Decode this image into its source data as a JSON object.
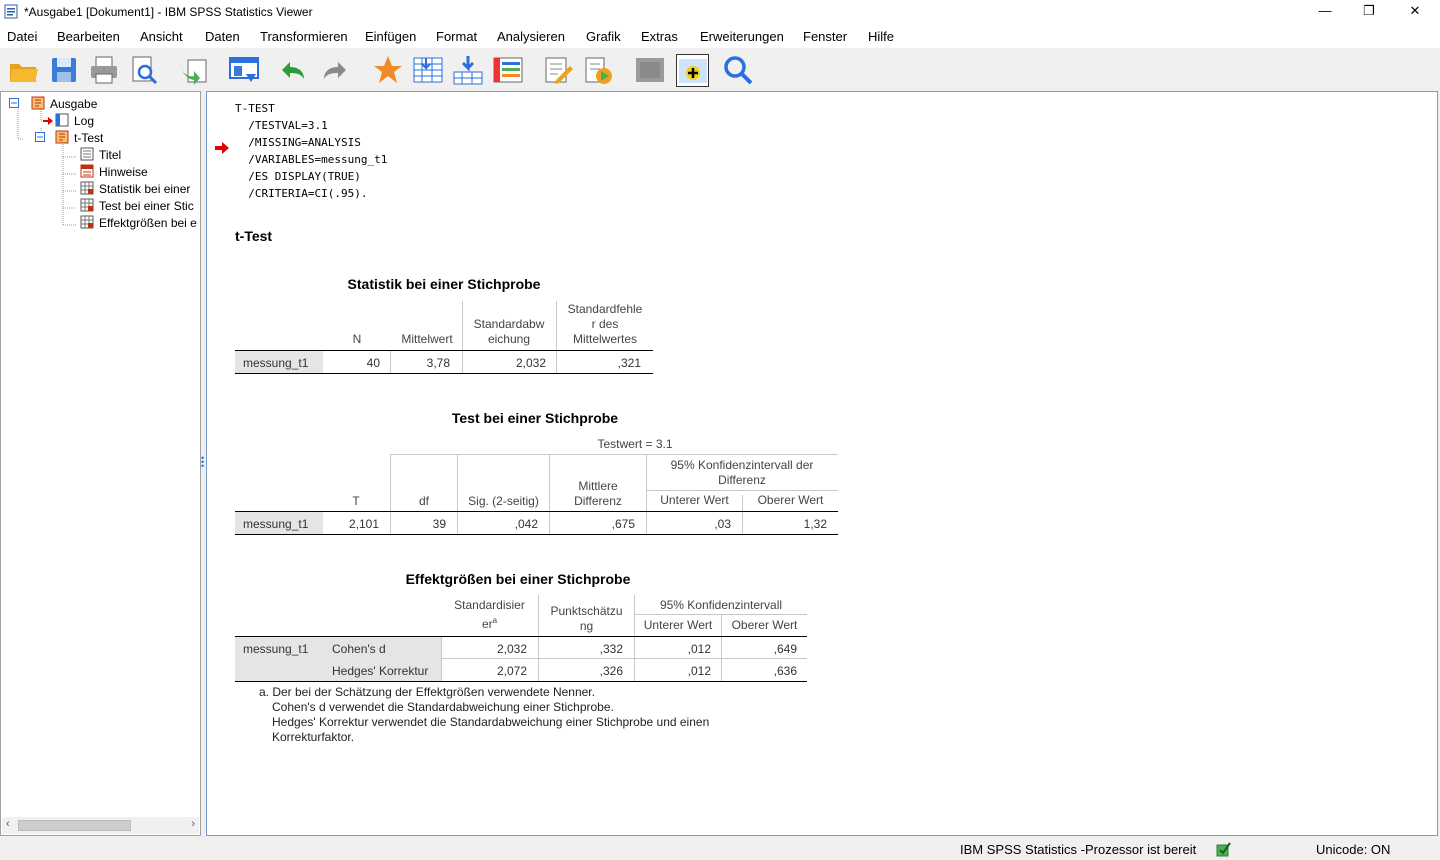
{
  "window": {
    "title": "*Ausgabe1 [Dokument1] - IBM SPSS Statistics Viewer",
    "minimize": "—",
    "maximize": "❐",
    "close": "✕"
  },
  "menu": [
    "Datei",
    "Bearbeiten",
    "Ansicht",
    "Daten",
    "Transformieren",
    "Einfügen",
    "Format",
    "Analysieren",
    "Grafik",
    "Extras",
    "Erweiterungen",
    "Fenster",
    "Hilfe"
  ],
  "toolbar": [
    "open-icon",
    "save-icon",
    "print-icon",
    "print-preview-icon",
    "export-icon",
    "goto-data-icon",
    "undo-icon",
    "redo-icon",
    "star-icon",
    "goto-case-icon",
    "insert-icon",
    "variables-icon",
    "edit-icon",
    "run-icon",
    "designated-window-icon",
    "add-output-icon",
    "find-icon"
  ],
  "tree": [
    {
      "label": "Ausgabe",
      "level": 0
    },
    {
      "label": "Log",
      "level": 1
    },
    {
      "label": "t-Test",
      "level": 1
    },
    {
      "label": "Titel",
      "level": 2
    },
    {
      "label": "Hinweise",
      "level": 2
    },
    {
      "label": "Statistik bei einer",
      "level": 2
    },
    {
      "label": "Test bei einer Stic",
      "level": 2
    },
    {
      "label": "Effektgrößen bei e",
      "level": 2
    }
  ],
  "syntax": [
    "T-TEST",
    "  /TESTVAL=3.1",
    "  /MISSING=ANALYSIS",
    "  /VARIABLES=messung_t1",
    "  /ES DISPLAY(TRUE)",
    "  /CRITERIA=CI(.95)."
  ],
  "heading": "t-Test",
  "table1": {
    "title": "Statistik bei einer Stichprobe",
    "headers": [
      "N",
      "Mittelwert",
      "Standardabw\neichung",
      "Standardfehle\nr des\nMittelwertes"
    ],
    "row_label": "messung_t1",
    "values": [
      "40",
      "3,78",
      "2,032",
      ",321"
    ]
  },
  "table2": {
    "title": "Test bei einer Stichprobe",
    "testwert": "Testwert = 3.1",
    "headers": [
      "T",
      "df",
      "Sig. (2-seitig)",
      "Mittlere\nDifferenz"
    ],
    "ci_header": "95% Konfidenzintervall der\nDifferenz",
    "ci_sub": [
      "Unterer Wert",
      "Oberer Wert"
    ],
    "row_label": "messung_t1",
    "values": [
      "2,101",
      "39",
      ",042",
      ",675",
      ",03",
      "1,32"
    ]
  },
  "table3": {
    "title": "Effektgrößen bei einer Stichprobe",
    "headers": [
      "Standardisier\ner",
      "a",
      "Punktschätzu\nng"
    ],
    "ci_header": "95% Konfidenzintervall",
    "ci_sub": [
      "Unterer Wert",
      "Oberer Wert"
    ],
    "row_label": "messung_t1",
    "rows": [
      {
        "label": "Cohen's d",
        "values": [
          "2,032",
          ",332",
          ",012",
          ",649"
        ]
      },
      {
        "label": "Hedges' Korrektur",
        "values": [
          "2,072",
          ",326",
          ",012",
          ",636"
        ]
      }
    ],
    "footnote": [
      "a. Der bei der Schätzung der Effektgrößen verwendete Nenner.",
      "Cohen's d verwendet die Standardabweichung einer Stichprobe.",
      "Hedges' Korrektur verwendet die Standardabweichung einer Stichprobe und einen",
      "Korrekturfaktor."
    ]
  },
  "status": {
    "processor": "IBM SPSS Statistics -Prozessor ist bereit",
    "unicode": "Unicode: ON"
  },
  "colors": {
    "accent": "#2a6fdb",
    "selection_bg": "#e5e5e5",
    "arrow": "#e00000"
  }
}
